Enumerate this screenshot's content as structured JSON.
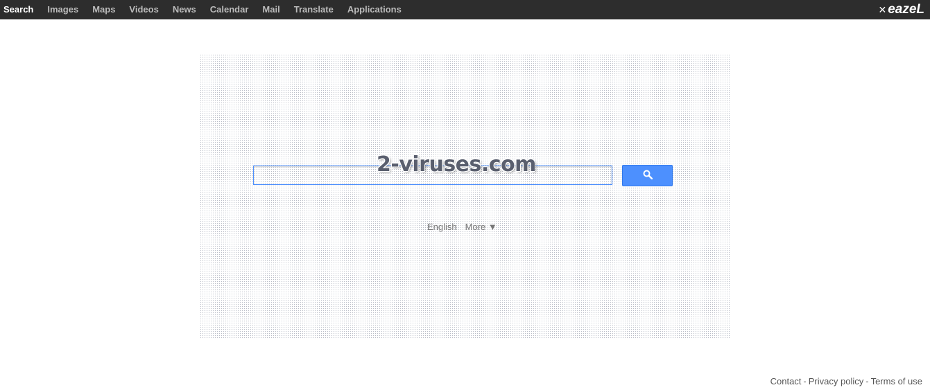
{
  "nav": {
    "items": [
      {
        "label": "Search",
        "active": true
      },
      {
        "label": "Images"
      },
      {
        "label": "Maps"
      },
      {
        "label": "Videos"
      },
      {
        "label": "News"
      },
      {
        "label": "Calendar"
      },
      {
        "label": "Mail"
      },
      {
        "label": "Translate"
      },
      {
        "label": "Applications"
      }
    ]
  },
  "brand": {
    "mark": "✕",
    "name": "eazeL"
  },
  "search": {
    "value": "",
    "placeholder": "",
    "button_icon": "search-icon"
  },
  "language": {
    "current": "English",
    "more": "More ▼"
  },
  "watermark": {
    "text": "2-viruses.com"
  },
  "footer": {
    "contact": "Contact",
    "privacy": "Privacy policy",
    "terms": "Terms of use",
    "separator": "-"
  },
  "colors": {
    "topbar": "#2d2d2d",
    "accent": "#4d90fe",
    "nav_active": "#ffffff",
    "nav_inactive": "#bbbbbb"
  }
}
